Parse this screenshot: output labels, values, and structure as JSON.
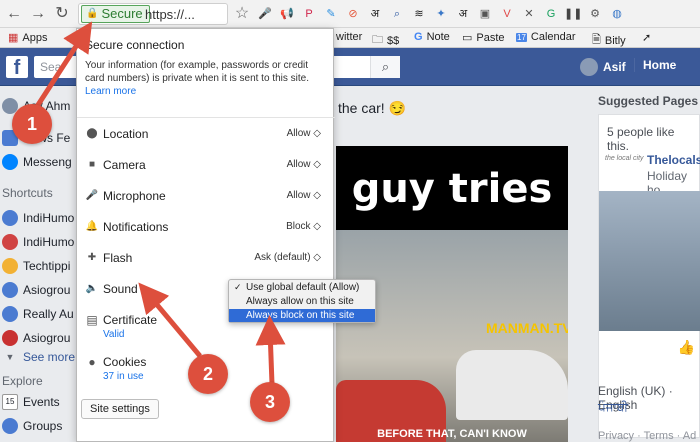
{
  "browser": {
    "secure_label": "Secure",
    "url": "https://...",
    "extensions": [
      {
        "icon": "microphone-icon",
        "glyph": "🎤",
        "color": "#333"
      },
      {
        "icon": "megaphone-icon",
        "glyph": "📢",
        "color": "#333"
      },
      {
        "icon": "pinterest-icon",
        "glyph": "P",
        "color": "#d0244a"
      },
      {
        "icon": "pencil-icon",
        "glyph": "✎",
        "color": "#2b8fe0"
      },
      {
        "icon": "no-entry-icon",
        "glyph": "⊘",
        "color": "#e5583c"
      },
      {
        "icon": "hindi-icon",
        "glyph": "अ",
        "color": "#222"
      },
      {
        "icon": "search-icon",
        "glyph": "⌕",
        "color": "#2f5aa3"
      },
      {
        "icon": "layers-icon",
        "glyph": "≋",
        "color": "#222"
      },
      {
        "icon": "tag-icon",
        "glyph": "✦",
        "color": "#3a78c8"
      },
      {
        "icon": "hindi-icon",
        "glyph": "अ",
        "color": "#222"
      },
      {
        "icon": "clipboard-icon",
        "glyph": "▣",
        "color": "#555"
      },
      {
        "icon": "vivaldi-icon",
        "glyph": "V",
        "color": "#e04848"
      },
      {
        "icon": "close-icon",
        "glyph": "✕",
        "color": "#555"
      },
      {
        "icon": "grammarly-icon",
        "glyph": "G",
        "color": "#18a05e"
      },
      {
        "icon": "pause-icon",
        "glyph": "❚❚",
        "color": "#444"
      },
      {
        "icon": "gear-icon",
        "glyph": "⚙",
        "color": "#555"
      },
      {
        "icon": "globe-icon",
        "glyph": "◍",
        "color": "#3a78c8"
      }
    ]
  },
  "bookmarks": {
    "apps": "Apps",
    "twitter": "witter",
    "money": "$$",
    "note": "Note",
    "paste": "Paste",
    "calendar": "Calendar",
    "calendar_day": "17",
    "bitly": "Bitly"
  },
  "fb": {
    "logo": "f",
    "search_placeholder": "Sea",
    "user_name": "Asif",
    "home": "Home"
  },
  "sidebar": {
    "profile": "Asif Ahm",
    "news_feed": "News Fe",
    "messenger": "Messeng",
    "shortcuts_heading": "Shortcuts",
    "shortcuts": [
      {
        "label": "IndiHumo",
        "color": "#4b7bd1"
      },
      {
        "label": "IndiHumo",
        "color": "#d04343"
      },
      {
        "label": "Techtippi",
        "color": "#f2b134"
      },
      {
        "label": "Asiogrou",
        "color": "#4b7bd1"
      },
      {
        "label": "Really Au",
        "color": "#4b7bd1"
      },
      {
        "label": "Asiogrou",
        "color": "#c83131"
      }
    ],
    "see_more": "See more",
    "explore_heading": "Explore",
    "events": "Events",
    "events_day": "15",
    "groups": "Groups"
  },
  "post": {
    "text": "the car! 😏",
    "video_title": "guy tries",
    "watermark": "MANMAN.TV",
    "caption": "BEFORE THAT, CAN'I KNOW"
  },
  "right": {
    "suggested": "Suggested Pages",
    "likes": "5 people like this.",
    "page_name": "Thelocals",
    "page_sub": "Holiday ho",
    "page_logo": "the local city",
    "lang": "English (UK) · English",
    "lang2": "ਪੰਜਾਬੀ",
    "footer": "Privacy · Terms · Ad"
  },
  "popup": {
    "title": "Secure connection",
    "desc": "Your information (for example, passwords or credit card numbers) is private when it is sent to this site.",
    "learn_more": "Learn more",
    "permissions": [
      {
        "label": "Location",
        "value": "Allow ◇",
        "icon": "location-pin-icon",
        "glyph": "⬤"
      },
      {
        "label": "Camera",
        "value": "Allow ◇",
        "icon": "camera-icon",
        "glyph": "■"
      },
      {
        "label": "Microphone",
        "value": "Allow ◇",
        "icon": "microphone-icon",
        "glyph": "🎤"
      },
      {
        "label": "Notifications",
        "value": "Block ◇",
        "icon": "bell-icon",
        "glyph": "🔔"
      },
      {
        "label": "Flash",
        "value": "Ask (default) ◇",
        "icon": "puzzle-icon",
        "glyph": "✚"
      },
      {
        "label": "Sound",
        "value": "",
        "icon": "speaker-icon",
        "glyph": "🔈"
      }
    ],
    "certificate": "Certificate",
    "certificate_status": "Valid",
    "cookies": "Cookies",
    "cookies_count": "37 in use",
    "site_settings": "Site settings"
  },
  "dropdown": {
    "options": [
      {
        "label": "Use global default (Allow)",
        "checked": "✓"
      },
      {
        "label": "Always allow on this site",
        "checked": ""
      },
      {
        "label": "Always block on this site",
        "checked": ""
      }
    ]
  },
  "annotations": {
    "badge1": "1",
    "badge2": "2",
    "badge3": "3",
    "color": "#dd4f3d"
  }
}
